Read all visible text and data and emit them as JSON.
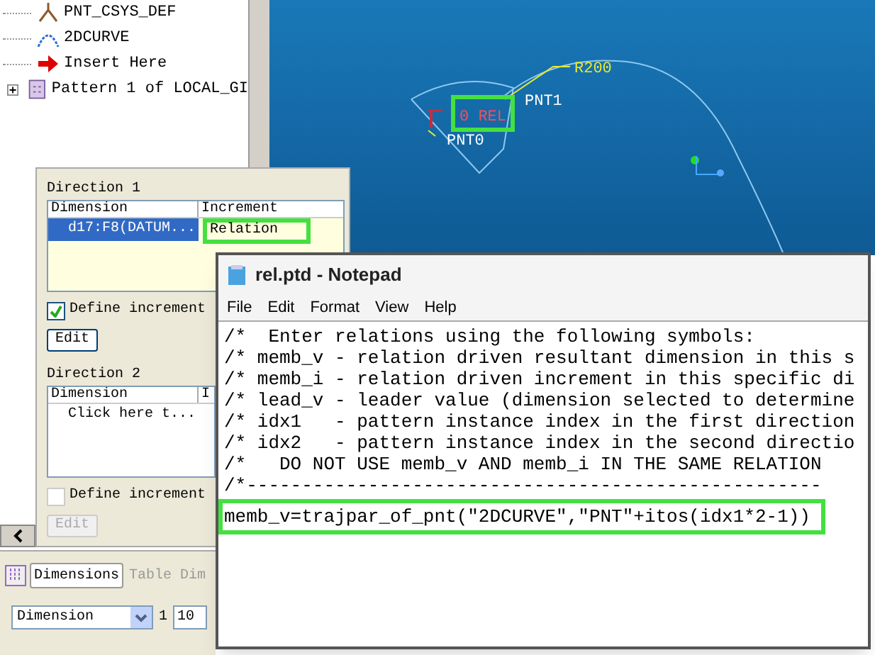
{
  "model_tree": {
    "items": [
      {
        "label": "PNT_CSYS_DEF",
        "kind": "csys"
      },
      {
        "label": "2DCURVE",
        "kind": "curve"
      },
      {
        "label": "Insert Here",
        "kind": "insert"
      },
      {
        "label": "Pattern 1 of LOCAL_GI",
        "kind": "pattern",
        "expanded": false
      }
    ]
  },
  "viewport": {
    "labels": [
      {
        "text": "R200",
        "kind": "dimension"
      },
      {
        "text": "0 REL",
        "kind": "relation"
      },
      {
        "text": "PNT1",
        "kind": "point"
      },
      {
        "text": "PNT0",
        "kind": "point"
      }
    ]
  },
  "directions": [
    {
      "title": "Direction 1",
      "columns": [
        "Dimension",
        "Increment"
      ],
      "rows": [
        {
          "dimension": "d17:F8(DATUM...",
          "increment": "Relation",
          "selected": true
        }
      ],
      "define_increment": {
        "label": "Define increment",
        "checked": true
      },
      "edit_button": {
        "label": "Edit",
        "disabled": false
      }
    },
    {
      "title": "Direction 2",
      "columns": [
        "Dimension",
        "I"
      ],
      "rows": [
        {
          "dimension": "Click here t...",
          "selected": false
        }
      ],
      "define_increment": {
        "label": "Define increment",
        "checked": false
      },
      "edit_button": {
        "label": "Edit",
        "disabled": true
      }
    }
  ],
  "bottom_tabs": [
    {
      "label": "Dimensions",
      "selected": true
    },
    {
      "label": "Table Dim",
      "selected": false
    }
  ],
  "dimension_select": {
    "value": "Dimension"
  },
  "count_label": "1",
  "count_field": {
    "value": "10"
  },
  "notepad": {
    "title": "rel.ptd - Notepad",
    "menu": [
      "File",
      "Edit",
      "Format",
      "View",
      "Help"
    ],
    "lines": [
      "/*  Enter relations using the following symbols:",
      "/* memb_v - relation driven resultant dimension in this s",
      "/* memb_i - relation driven increment in this specific di",
      "/* lead_v - leader value (dimension selected to determine",
      "/* idx1   - pattern instance index in the first direction",
      "/* idx2   - pattern instance index in the second directio",
      "/*   DO NOT USE memb_v AND memb_i IN THE SAME RELATION",
      "/*----------------------------------------------------",
      "memb_v=trajpar_of_pnt(\"2DCURVE\",\"PNT\"+itos(idx1*2-1))"
    ]
  }
}
